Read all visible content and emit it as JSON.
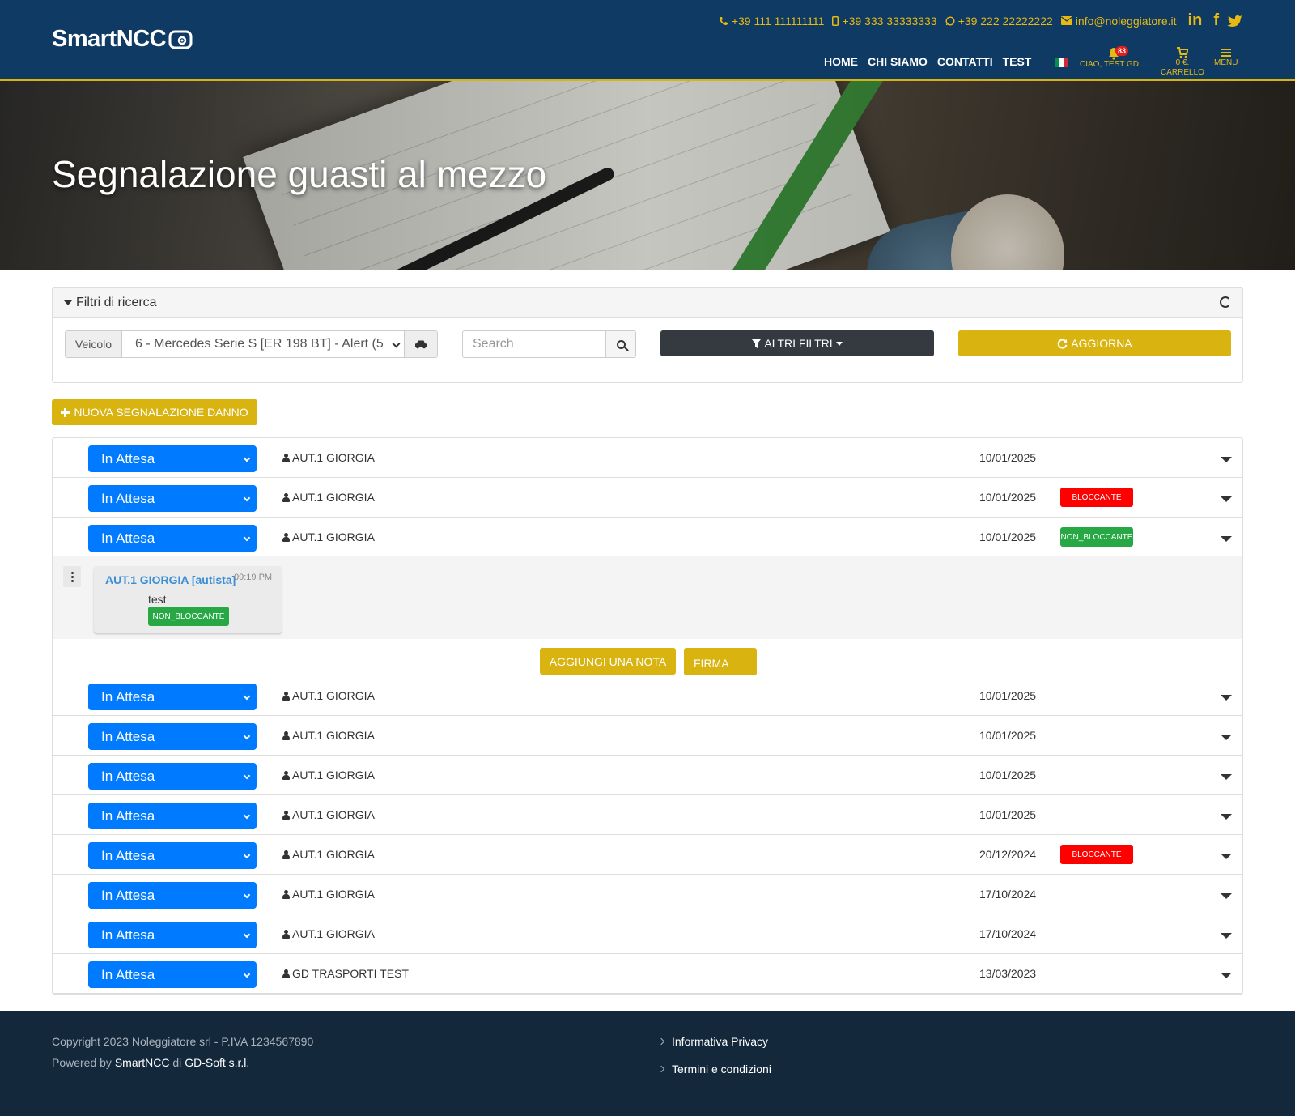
{
  "header": {
    "logo": "SmartNCC",
    "contacts": [
      {
        "icon": "phone-icon",
        "text": "+39 111 111111111"
      },
      {
        "icon": "mobile-icon",
        "text": "+39 333 33333333"
      },
      {
        "icon": "whatsapp-icon",
        "text": "+39 222 22222222"
      },
      {
        "icon": "envelope-icon",
        "text": "info@noleggiatore.it"
      }
    ],
    "social": [
      "linkedin-icon",
      "facebook-icon",
      "twitter-icon"
    ],
    "nav": [
      "HOME",
      "CHI SIAMO",
      "CONTATTI",
      "TEST"
    ],
    "notifications_count": "83",
    "user_label": "CIAO, TEST GD ...",
    "cart_amount": "0 €.",
    "cart_label": "CARRELLO",
    "menu_label": "MENU",
    "colors": {
      "bg": "#0e3a63",
      "accent": "#e8b912"
    }
  },
  "hero": {
    "title": "Segnalazione guasti al mezzo"
  },
  "filters": {
    "title": "Filtri di ricerca",
    "vehicle_label": "Veicolo",
    "vehicle_value": "6 - Mercedes Serie S [ER 198 BT] - Alert (5",
    "search_placeholder": "Search",
    "other_filters": "ALTRI FILTRI",
    "refresh": "AGGIORNA"
  },
  "new_report_button": "NUOVA SEGNALAZIONE DANNO",
  "reports": [
    {
      "status": "In Attesa",
      "author": "AUT.1 GIORGIA",
      "date": "10/01/2025",
      "tag": ""
    },
    {
      "status": "In Attesa",
      "author": "AUT.1 GIORGIA",
      "date": "10/01/2025",
      "tag": "BLOCCANTE"
    },
    {
      "status": "In Attesa",
      "author": "AUT.1 GIORGIA",
      "date": "10/01/2025",
      "tag": "NON_BLOCCANTE"
    },
    {
      "status": "In Attesa",
      "author": "AUT.1 GIORGIA",
      "date": "10/01/2025",
      "tag": ""
    },
    {
      "status": "In Attesa",
      "author": "AUT.1 GIORGIA",
      "date": "10/01/2025",
      "tag": ""
    },
    {
      "status": "In Attesa",
      "author": "AUT.1 GIORGIA",
      "date": "10/01/2025",
      "tag": ""
    },
    {
      "status": "In Attesa",
      "author": "AUT.1 GIORGIA",
      "date": "10/01/2025",
      "tag": ""
    },
    {
      "status": "In Attesa",
      "author": "AUT.1 GIORGIA",
      "date": "20/12/2024",
      "tag": "BLOCCANTE"
    },
    {
      "status": "In Attesa",
      "author": "AUT.1 GIORGIA",
      "date": "17/10/2024",
      "tag": ""
    },
    {
      "status": "In Attesa",
      "author": "AUT.1 GIORGIA",
      "date": "17/10/2024",
      "tag": ""
    },
    {
      "status": "In Attesa",
      "author": "GD TRASPORTI TEST",
      "date": "13/03/2023",
      "tag": ""
    }
  ],
  "expanded_note": {
    "author": "AUT.1 GIORGIA [autista]",
    "time": "09:19 PM",
    "text": "test",
    "tag": "NON_BLOCCANTE",
    "add_note": "AGGIUNGI UNA NOTA",
    "sign": "FIRMA"
  },
  "footer": {
    "copyright": "Copyright 2023 Noleggiatore srl - P.IVA 1234567890",
    "powered_prefix": "Powered by",
    "powered_product": "SmartNCC",
    "powered_mid": "di",
    "powered_company": "GD-Soft s.r.l.",
    "links": [
      "Informativa Privacy",
      "Termini e condizioni"
    ]
  },
  "colors": {
    "status_blue": "#007bff",
    "gold": "#d9b310",
    "red_tag": "#ff0000",
    "green_tag": "#28a745"
  }
}
